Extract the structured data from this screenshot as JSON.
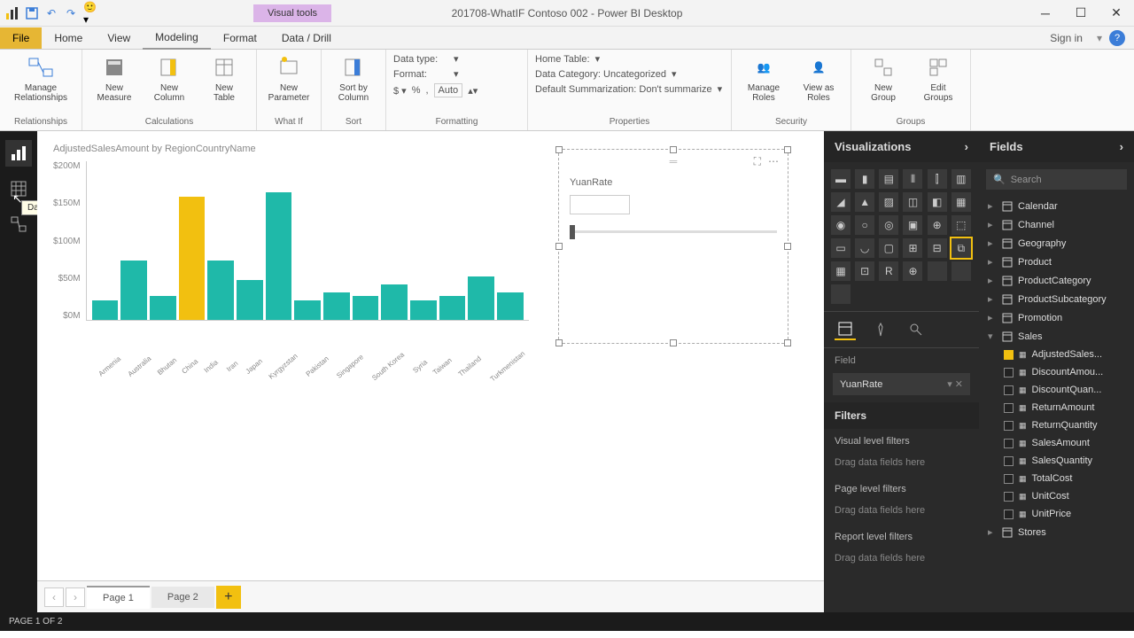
{
  "title": "201708-WhatIF Contoso 002 - Power BI Desktop",
  "visual_tools": "Visual tools",
  "menu": {
    "file": "File",
    "home": "Home",
    "view": "View",
    "modeling": "Modeling",
    "format": "Format",
    "datadrill": "Data / Drill",
    "signin": "Sign in"
  },
  "ribbon": {
    "relationships": {
      "btn": "Manage\nRelationships",
      "group": "Relationships"
    },
    "calc": {
      "measure": "New\nMeasure",
      "column": "New\nColumn",
      "table": "New\nTable",
      "group": "Calculations"
    },
    "whatif": {
      "param": "New\nParameter",
      "group": "What If"
    },
    "sort": {
      "btn": "Sort by\nColumn",
      "group": "Sort"
    },
    "formatting": {
      "datatype": "Data type:",
      "format": "Format:",
      "auto": "Auto",
      "group": "Formatting"
    },
    "properties": {
      "home": "Home Table:",
      "cat": "Data Category: Uncategorized",
      "summ": "Default Summarization: Don't summarize",
      "group": "Properties"
    },
    "security": {
      "manage": "Manage\nRoles",
      "view": "View as\nRoles",
      "group": "Security"
    },
    "groups": {
      "new": "New\nGroup",
      "edit": "Edit\nGroups",
      "group": "Groups"
    }
  },
  "tooltip": "Data",
  "chart_data": {
    "type": "bar",
    "title": "AdjustedSalesAmount by RegionCountryName",
    "ylabel": "",
    "xlabel": "",
    "ylim": [
      0,
      200
    ],
    "y_ticks": [
      "$200M",
      "$150M",
      "$100M",
      "$50M",
      "$0M"
    ],
    "categories": [
      "Armenia",
      "Australia",
      "Bhutan",
      "China",
      "India",
      "Iran",
      "Japan",
      "Kyrgyzstan",
      "Pakistan",
      "Singapore",
      "South Korea",
      "Syria",
      "Taiwan",
      "Thailand",
      "Turkmenistan"
    ],
    "values": [
      25,
      75,
      30,
      155,
      75,
      50,
      160,
      25,
      35,
      30,
      45,
      25,
      30,
      55,
      35
    ],
    "highlight": "China"
  },
  "slicer": {
    "title": "YuanRate"
  },
  "pages": {
    "p1": "Page 1",
    "p2": "Page 2"
  },
  "viz": {
    "header": "Visualizations",
    "field_label": "Field",
    "field_value": "YuanRate",
    "filters": "Filters",
    "vlf": "Visual level filters",
    "plf": "Page level filters",
    "rlf": "Report level filters",
    "drag": "Drag data fields here"
  },
  "fields": {
    "header": "Fields",
    "search": "Search",
    "tables": [
      "Calendar",
      "Channel",
      "Geography",
      "Product",
      "ProductCategory",
      "ProductSubcategory",
      "Promotion",
      "Sales",
      "Stores"
    ],
    "sales_cols": [
      "AdjustedSales...",
      "DiscountAmou...",
      "DiscountQuan...",
      "ReturnAmount",
      "ReturnQuantity",
      "SalesAmount",
      "SalesQuantity",
      "TotalCost",
      "UnitCost",
      "UnitPrice"
    ]
  },
  "status": "PAGE 1 OF 2"
}
